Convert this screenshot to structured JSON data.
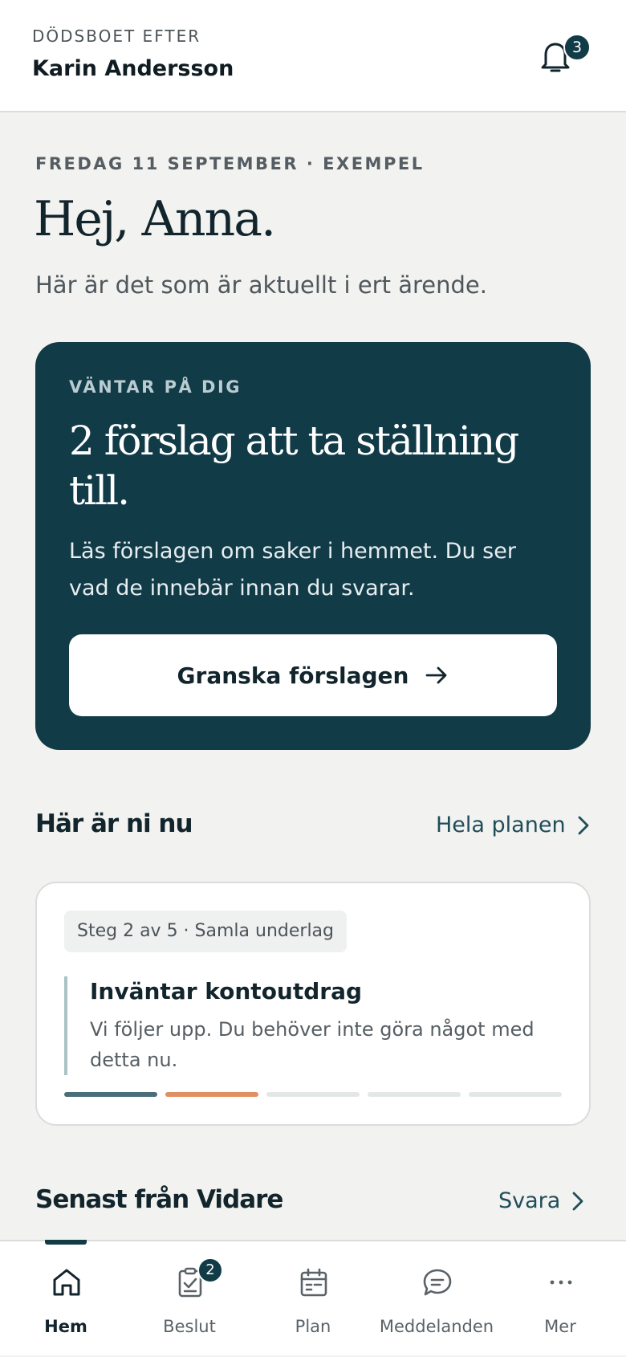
{
  "header": {
    "estate_label": "DÖDSBOET EFTER",
    "estate_name": "Karin Andersson",
    "notification_count": "3"
  },
  "intro": {
    "date": "FREDAG 11 SEPTEMBER · EXEMPEL",
    "greeting": "Hej, Anna.",
    "subtitle": "Här är det som är aktuellt i ert ärende."
  },
  "action_card": {
    "eyebrow": "VÄNTAR PÅ DIG",
    "title": "2 förslag att ta ställning till.",
    "text": "Läs förslagen om saker i hemmet. Du ser vad de innebär innan du svarar.",
    "button_label": "Granska förslagen"
  },
  "plan_section": {
    "title": "Här är ni nu",
    "link": "Hela planen",
    "step_chip": "Steg 2 av 5 · Samla underlag",
    "status_title": "Inväntar kontoutdrag",
    "status_text": "Vi följer upp. Du behöver inte göra något med detta nu.",
    "progress": {
      "total_steps": 5,
      "current_step": 2,
      "colors": [
        "#4a6e7a",
        "#e08f62",
        "#e3e8e6",
        "#e3e8e6",
        "#e3e8e6"
      ]
    }
  },
  "latest_section": {
    "title": "Senast från Vidare",
    "link": "Svara"
  },
  "tabbar": {
    "tabs": [
      {
        "label": "Hem",
        "icon": "home-icon",
        "active": true
      },
      {
        "label": "Beslut",
        "icon": "clipboard-check-icon",
        "badge": "2"
      },
      {
        "label": "Plan",
        "icon": "calendar-icon"
      },
      {
        "label": "Meddelanden",
        "icon": "chat-bubble-icon"
      },
      {
        "label": "Mer",
        "icon": "more-dots-icon"
      }
    ]
  },
  "colors": {
    "accent": "#123b48",
    "background": "#f2f2f0",
    "link": "#1f4d5a",
    "progress_active": "#4a6e7a",
    "progress_current": "#e08f62"
  }
}
